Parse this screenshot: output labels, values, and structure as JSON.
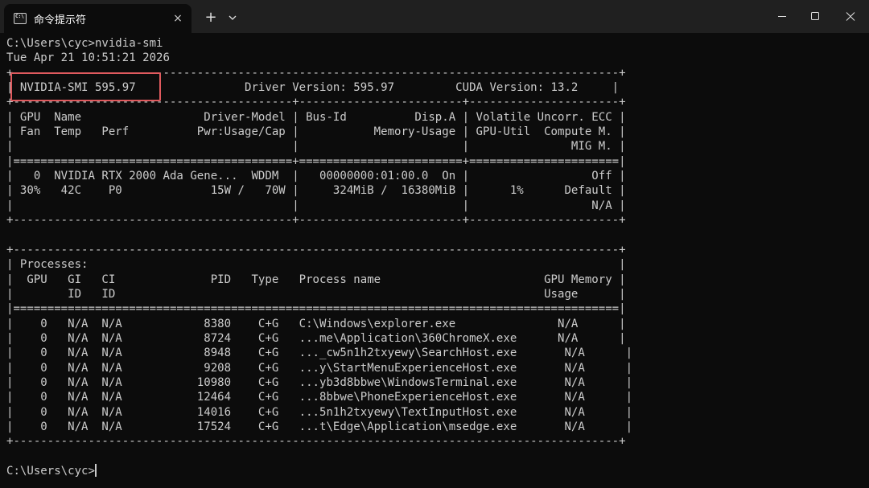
{
  "tab": {
    "title": "命令提示符",
    "icon": "cmd-icon",
    "close_icon": "×"
  },
  "titlebar": {
    "new_tab_icon": "+"
  },
  "terminal": {
    "lines": [
      "C:\\Users\\cyc>nvidia-smi",
      "Tue Apr 21 10:51:21 2026",
      "+-----------------------------------------------------------------------------------------+",
      "| NVIDIA-SMI 595.97                Driver Version: 595.97         CUDA Version: 13.2     |",
      "+-----------------------------------------+------------------------+----------------------+",
      "| GPU  Name                  Driver-Model | Bus-Id          Disp.A | Volatile Uncorr. ECC |",
      "| Fan  Temp   Perf          Pwr:Usage/Cap |           Memory-Usage | GPU-Util  Compute M. |",
      "|                                         |                        |               MIG M. |",
      "|=========================================+========================+======================|",
      "|   0  NVIDIA RTX 2000 Ada Gene...  WDDM  |   00000000:01:00.0  On |                  Off |",
      "| 30%   42C    P0             15W /   70W |     324MiB /  16380MiB |      1%      Default |",
      "|                                         |                        |                  N/A |",
      "+-----------------------------------------+------------------------+----------------------+",
      "",
      "+-----------------------------------------------------------------------------------------+",
      "| Processes:                                                                              |",
      "|  GPU   GI   CI              PID   Type   Process name                        GPU Memory |",
      "|        ID   ID                                                               Usage      |",
      "|=========================================================================================|",
      "|    0   N/A  N/A            8380    C+G   C:\\Windows\\explorer.exe               N/A      |",
      "|    0   N/A  N/A            8724    C+G   ...me\\Application\\360ChromeX.exe      N/A      |",
      "|    0   N/A  N/A            8948    C+G   ..._cw5n1h2txyewy\\SearchHost.exe       N/A      |",
      "|    0   N/A  N/A            9208    C+G   ...y\\StartMenuExperienceHost.exe       N/A      |",
      "|    0   N/A  N/A           10980    C+G   ...yb3d8bbwe\\WindowsTerminal.exe       N/A      |",
      "|    0   N/A  N/A           12464    C+G   ...8bbwe\\PhoneExperienceHost.exe       N/A      |",
      "|    0   N/A  N/A           14016    C+G   ...5n1h2txyewy\\TextInputHost.exe       N/A      |",
      "|    0   N/A  N/A           17524    C+G   ...t\\Edge\\Application\\msedge.exe       N/A      |",
      "+-----------------------------------------------------------------------------------------+",
      "",
      "C:\\Users\\cyc>"
    ]
  },
  "colors": {
    "background": "#0c0c0c",
    "text": "#cccccc",
    "titlebar": "#202020",
    "highlight": "#e05a5e"
  }
}
